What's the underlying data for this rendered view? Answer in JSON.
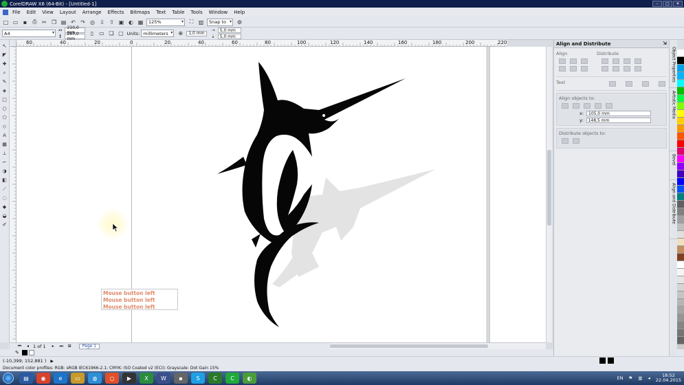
{
  "window": {
    "title": "CorelDRAW X6 (64-Bit) - [Untitled-1]",
    "controls": [
      "–",
      "□",
      "✕"
    ]
  },
  "menu": [
    "File",
    "Edit",
    "View",
    "Layout",
    "Arrange",
    "Effects",
    "Bitmaps",
    "Text",
    "Table",
    "Tools",
    "Window",
    "Help"
  ],
  "toolbar": {
    "zoom": "125%",
    "snap": "Snap to"
  },
  "propbar": {
    "paper": "A4",
    "width": "210,0 mm",
    "height": "297,0 mm",
    "units_label": "Units:",
    "units": "millimeters",
    "nudge": "1,0 mm",
    "dup_x": "5,0 mm",
    "dup_y": "5,0 mm"
  },
  "rulers": {
    "h_ticks": [
      "60",
      "40",
      "20",
      "0",
      "20",
      "40",
      "60",
      "80",
      "100",
      "120",
      "140",
      "160",
      "180",
      "200",
      "220"
    ],
    "unit": "millimeters"
  },
  "canvas": {
    "tooltip_lines": [
      "Mouse button left",
      "Mouse button left",
      "Mouse button left"
    ]
  },
  "page_nav": {
    "count": "1 of 1",
    "page_tab": "Page 1"
  },
  "status": {
    "coords": "(-10,399; 152,881 )",
    "profiles": "Document color profiles: RGB: sRGB IEC61966-2.1; CMYK: ISO Coated v2 (ECI); Grayscale: Dot Gain 15%"
  },
  "docker": {
    "title": "Align and Distribute",
    "align_label": "Align",
    "distribute_label": "Distribute",
    "text_label": "Text",
    "align_objects_to": "Align objects to:",
    "x_value": "105,0 mm",
    "y_value": "148,5 mm",
    "distribute_objects_to": "Distribute objects to:"
  },
  "docker_tabs": [
    "Object Properties",
    "Artistic Media",
    "Bevel",
    "Align and Distribute"
  ],
  "palette_colors": [
    "#ffffff",
    "#000000",
    "#00a2e8",
    "#00b4ff",
    "#00ffff",
    "#00c000",
    "#00ff40",
    "#80ff00",
    "#ffff00",
    "#ffd000",
    "#ff9900",
    "#ff5500",
    "#ff0000",
    "#e00070",
    "#ff00ff",
    "#9000ff",
    "#4000c0",
    "#0000ff",
    "#0050ff",
    "#008080",
    "#606060",
    "#808080",
    "#a0a0a0",
    "#c0c0c0",
    "#e0e0e0",
    "#f0e0c0",
    "#c09060",
    "#804020",
    "#ffffff",
    "#f5f5f5",
    "#e5e5e5",
    "#d5d5d5",
    "#c5c5c5",
    "#b5b5b5",
    "#a5a5a5",
    "#959595",
    "#858585",
    "#757575",
    "#656565"
  ],
  "taskbar": {
    "lang": "EN",
    "time": "18:52",
    "date": "22.04.2015"
  }
}
